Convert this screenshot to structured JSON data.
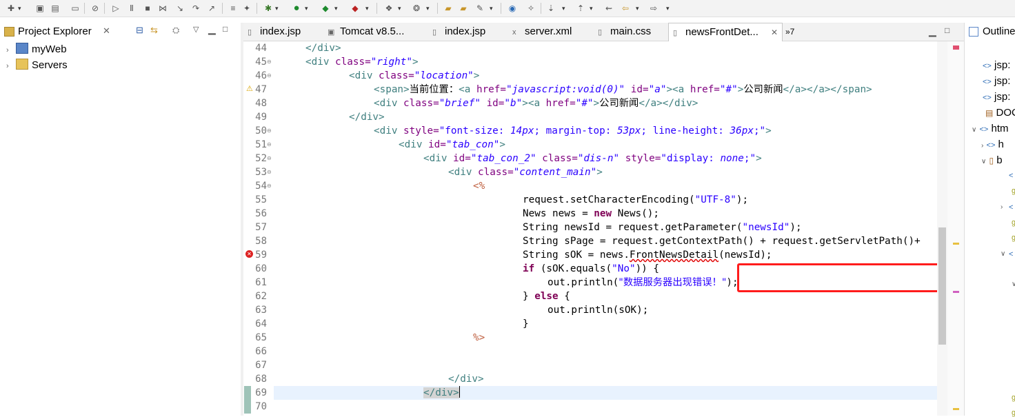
{
  "toolbar": {
    "icons": [
      "new-icon",
      "save-icon",
      "save-all-icon",
      "print-icon",
      "skip-breakpoints-icon",
      "resume-icon",
      "suspend-icon",
      "terminate-icon",
      "disconnect-icon",
      "step-into-icon",
      "step-over-icon",
      "step-return-icon",
      "drop-frame-icon",
      "debug-icon",
      "run-icon",
      "run-last-icon",
      "external-tools-icon",
      "new-server-icon",
      "new-java-project-icon",
      "open-type-icon",
      "open-task-icon",
      "search-icon",
      "next-annotation-icon",
      "previous-annotation-icon",
      "last-edit-icon",
      "back-icon",
      "forward-icon"
    ]
  },
  "explorer": {
    "title": "Project Explorer",
    "tree": [
      {
        "label": "myWeb",
        "icon": "web-project-icon"
      },
      {
        "label": "Servers",
        "icon": "folder-icon"
      }
    ]
  },
  "editor": {
    "tabs": [
      {
        "label": "index.jsp",
        "icon": "jsp-file-icon",
        "active": false
      },
      {
        "label": "Tomcat v8.5...",
        "icon": "server-icon",
        "active": false
      },
      {
        "label": "index.jsp",
        "icon": "jsp-file-icon",
        "active": false
      },
      {
        "label": "server.xml",
        "icon": "xml-file-icon",
        "active": false
      },
      {
        "label": "main.css",
        "icon": "css-file-icon",
        "active": false
      },
      {
        "label": "newsFrontDet...",
        "icon": "jsp-file-icon",
        "active": true
      }
    ],
    "overflow_count": "»7",
    "line_numbers": [
      "44",
      "45",
      "46",
      "47",
      "48",
      "49",
      "50",
      "51",
      "52",
      "53",
      "54",
      "55",
      "56",
      "57",
      "58",
      "59",
      "60",
      "61",
      "62",
      "63",
      "64",
      "65",
      "66",
      "67",
      "68",
      "69",
      "70"
    ],
    "lines": {
      "l44_close_div": "</div>",
      "l45_open": "<div ",
      "l45_attr": "class=",
      "l45_val": "\"right\"",
      "l45_end": ">",
      "l46_open": "<div ",
      "l46_attr": "class=",
      "l46_val": "\"location\"",
      "l46_end": ">",
      "l47_span": "<span>",
      "l47_text": "当前位置：",
      "l47_a": "<a ",
      "l47_href": "href=",
      "l47_hrefval": "\"javascript:void(0)\"",
      "l47_id": " id=",
      "l47_idval": "\"a\"",
      "l47_gt": "><a ",
      "l47_href2": "href=",
      "l47_hrefval2": "\"#\"",
      "l47_gt2": ">",
      "l47_text2": "公司新闻",
      "l47_close": "</a></a></span>",
      "l48_open": "<div ",
      "l48_attr": "class=",
      "l48_val": "\"brief\"",
      "l48_id": " id=",
      "l48_idval": "\"b\"",
      "l48_a": "><a ",
      "l48_href": "href=",
      "l48_hrefval": "\"#\"",
      "l48_gt": ">",
      "l48_text": "公司新闻",
      "l48_close": "</a></div>",
      "l49_close_div": "</div>",
      "l50_open": "<div ",
      "l50_attr": "style=",
      "l50_q1": "\"font-size: ",
      "l50_v1": "14px",
      "l50_q2": "; margin-top: ",
      "l50_v2": "53px",
      "l50_q3": "; line-height: ",
      "l50_v3": "36px",
      "l50_q4": ";\"",
      "l50_end": ">",
      "l51_open": "<div ",
      "l51_attr": "id=",
      "l51_val": "\"tab_con\"",
      "l51_end": ">",
      "l52_open": "<div ",
      "l52_attr": "id=",
      "l52_val": "\"tab_con_2\"",
      "l52_attr2": " class=",
      "l52_val2": "\"dis-n\"",
      "l52_attr3": " style=",
      "l52_q1": "\"display: ",
      "l52_v1": "none",
      "l52_q2": ";\"",
      "l52_end": ">",
      "l53_open": "<div ",
      "l53_attr": "class=",
      "l53_val": "\"content_main\"",
      "l53_end": ">",
      "l54_scriptlet": "<%",
      "l55_a": "request.setCharacterEncoding(",
      "l55_s": "\"UTF-8\"",
      "l55_b": ");",
      "l56_a": "News news = ",
      "l56_kw": "new",
      "l56_b": " News();",
      "l57_a": "String newsId = request.getParameter(",
      "l57_s": "\"newsId\"",
      "l57_b": ");",
      "l58": "String sPage = request.getContextPath() + request.getServletPath()+",
      "l59_a": "String sOK = news.",
      "l59_m": "FrontNewsDetail",
      "l59_b": "(newsId);",
      "l60_kw": "if",
      "l60_a": " (sOK.equals(",
      "l60_s": "\"No\"",
      "l60_b": ")) {",
      "l61_a": "out.println(",
      "l61_s": "\"数据服务器出现错误！\"",
      "l61_b": ");",
      "l62_a": "} ",
      "l62_kw": "else",
      "l62_b": " {",
      "l63": "out.println(sOK);",
      "l64": "}",
      "l65_scriptlet": "%>",
      "l68_close_div": "</div>",
      "l69_close_div": "</div>"
    }
  },
  "outline": {
    "title": "Outline",
    "rows": [
      "jsp:",
      "jsp:",
      "jsp:",
      "DOC",
      "htm",
      "h",
      "b"
    ]
  }
}
